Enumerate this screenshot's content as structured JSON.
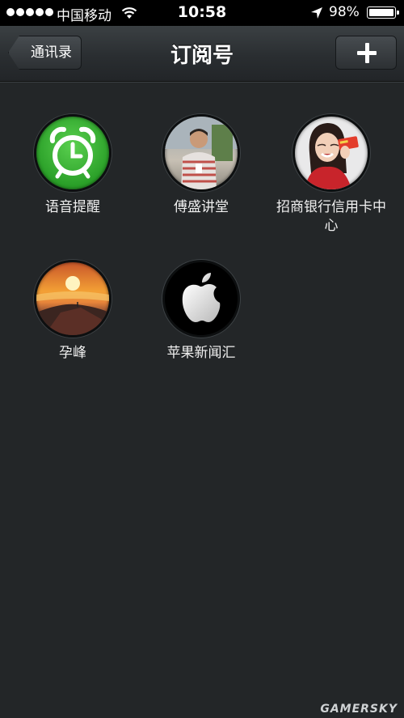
{
  "status_bar": {
    "carrier": "中国移动",
    "time": "10:58",
    "battery_percent": "98%"
  },
  "nav": {
    "back_label": "通讯录",
    "title": "订阅号",
    "add_icon": "plus-icon"
  },
  "subscriptions": [
    {
      "name": "语音提醒",
      "icon": "alarm-clock-icon"
    },
    {
      "name": "傅盛讲堂",
      "icon": "person-photo"
    },
    {
      "name": "招商银行信用卡中心",
      "icon": "woman-card-photo"
    },
    {
      "name": "孕峰",
      "icon": "sunset-mountain-photo"
    },
    {
      "name": "苹果新闻汇",
      "icon": "apple-logo-icon"
    }
  ],
  "watermark": "GAMERSKY"
}
